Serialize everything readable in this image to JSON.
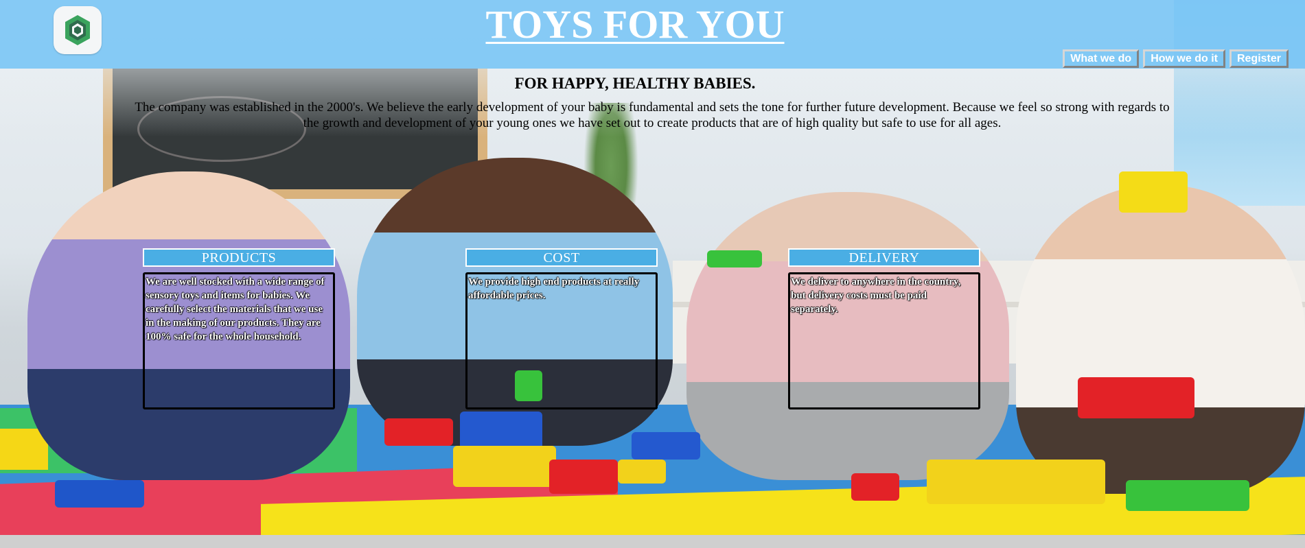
{
  "header": {
    "title": "TOYS FOR YOU",
    "logo_icon": "app-logo-icon",
    "background_color": "#7dc7f5"
  },
  "nav": {
    "items": [
      {
        "label": "What we do"
      },
      {
        "label": "How we do it"
      },
      {
        "label": "Register"
      }
    ]
  },
  "hero": {
    "tagline": "FOR HAPPY, HEALTHY BABIES.",
    "intro": "The company was established in the 2000's. We believe the early development of your baby is fundamental and sets the tone for further future development. Because we feel so strong with regards to the growth and development of your young ones we have set out to create products that are of high quality but safe to use for all ages."
  },
  "cards": [
    {
      "title": "PRODUCTS",
      "text": "We are well stocked with a wide range of sensory toys and items for babies. We carefully select the materials that we use in the making of our products. They are 100% safe for the whole household."
    },
    {
      "title": "COST",
      "text": "We provide high end products at really affordable prices."
    },
    {
      "title": "DELIVERY",
      "text": "We deliver to anywhere in the country, but delivery costs must be paid separately."
    }
  ],
  "colors": {
    "card_title_bg": "#4aaee4",
    "card_border": "#000000"
  }
}
